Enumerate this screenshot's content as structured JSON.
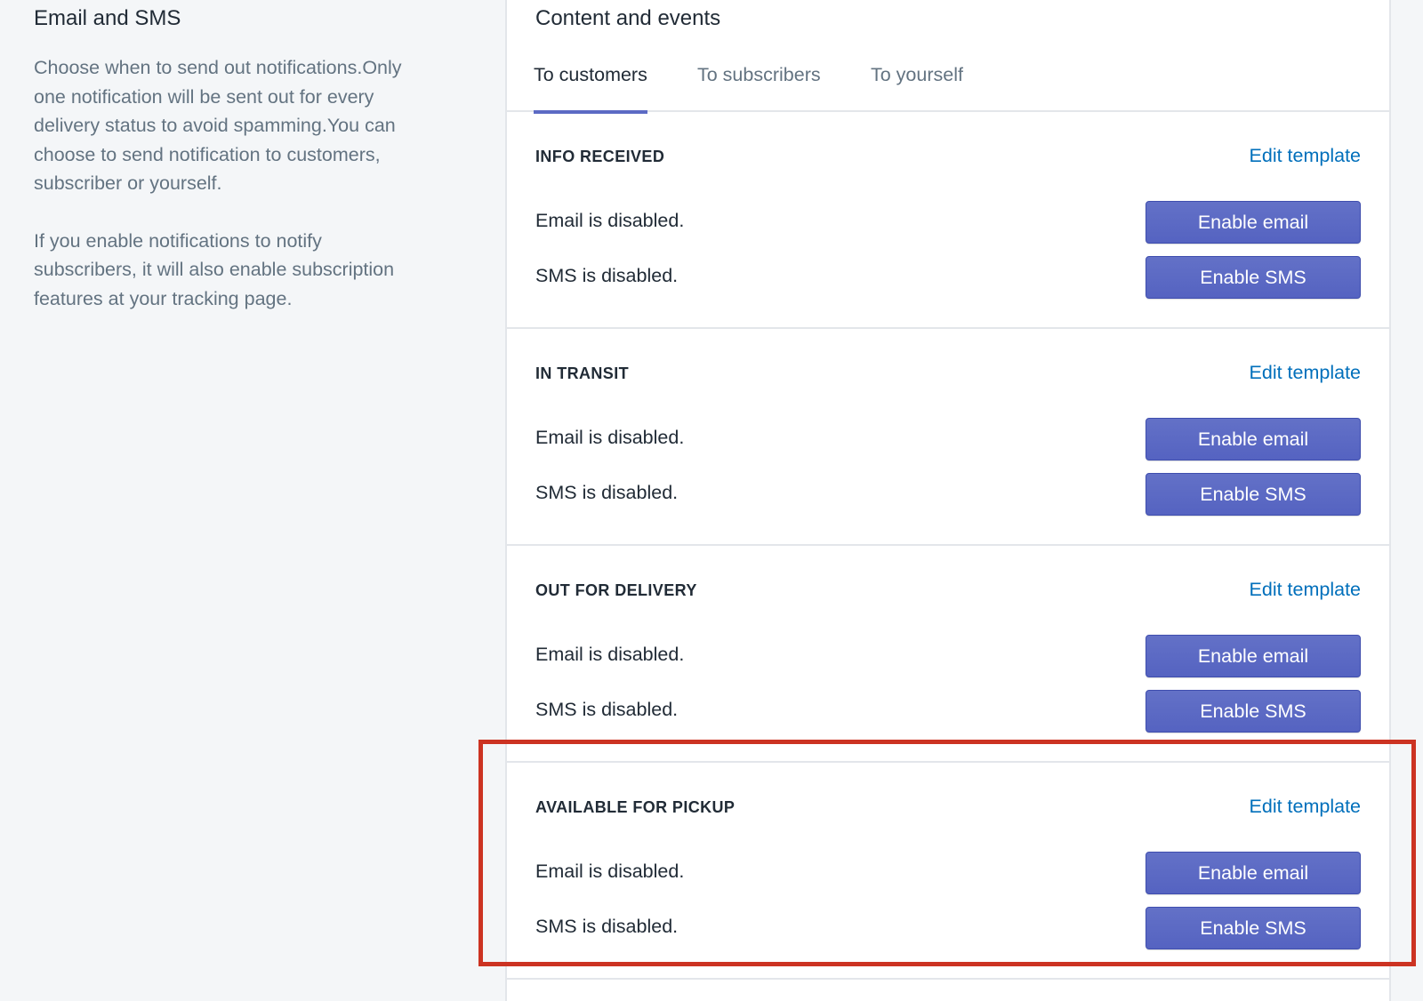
{
  "sidebar": {
    "title": "Email and SMS",
    "description": "Choose when to send out notifications.Only one notification will be sent out for every delivery status to avoid spamming.You can choose to send notification to customers, subscriber or yourself.",
    "note": "If you enable notifications to notify subscribers, it will also enable subscription features at your tracking page."
  },
  "card": {
    "title": "Content and events",
    "tabs": [
      {
        "label": "To customers",
        "active": true
      },
      {
        "label": "To subscribers",
        "active": false
      },
      {
        "label": "To yourself",
        "active": false
      }
    ],
    "sections": [
      {
        "title": "INFO RECEIVED",
        "edit_label": "Edit template",
        "email_status": "Email is disabled.",
        "email_button": "Enable email",
        "sms_status": "SMS is disabled.",
        "sms_button": "Enable SMS"
      },
      {
        "title": "IN TRANSIT",
        "edit_label": "Edit template",
        "email_status": "Email is disabled.",
        "email_button": "Enable email",
        "sms_status": "SMS is disabled.",
        "sms_button": "Enable SMS"
      },
      {
        "title": "OUT FOR DELIVERY",
        "edit_label": "Edit template",
        "email_status": "Email is disabled.",
        "email_button": "Enable email",
        "sms_status": "SMS is disabled.",
        "sms_button": "Enable SMS"
      },
      {
        "title": "AVAILABLE FOR PICKUP",
        "edit_label": "Edit template",
        "email_status": "Email is disabled.",
        "email_button": "Enable email",
        "sms_status": "SMS is disabled.",
        "sms_button": "Enable SMS"
      }
    ]
  },
  "colors": {
    "accent": "#5c6ac4",
    "link": "#006fbb",
    "highlight": "#cc3322"
  }
}
